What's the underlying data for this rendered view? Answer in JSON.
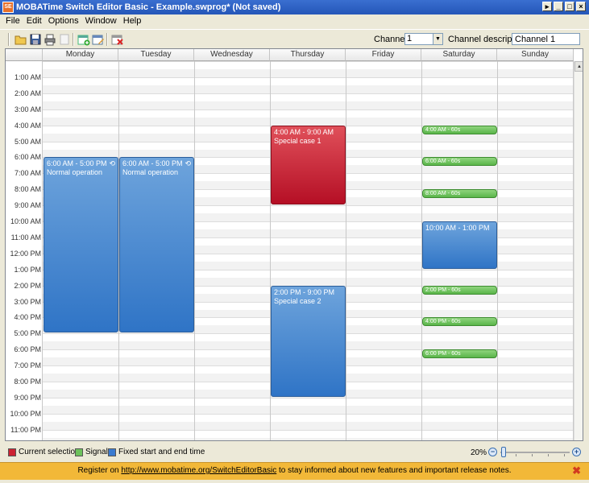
{
  "window": {
    "title": "MOBATime Switch Editor Basic - Example.swprog* (Not saved)",
    "icon_text": "SE"
  },
  "menu": [
    "File",
    "Edit",
    "Options",
    "Window",
    "Help"
  ],
  "toolbar": {
    "icons": [
      "new-document-icon",
      "open-folder-icon",
      "save-icon",
      "print-icon",
      "blank-icon",
      "add-event-icon",
      "edit-event-icon",
      "delete-event-icon"
    ],
    "channel_label": "Channel:",
    "channel_value": "1",
    "description_label": "Channel description:",
    "description_value": "Channel 1"
  },
  "calendar": {
    "days": [
      "Monday",
      "Tuesday",
      "Wednesday",
      "Thursday",
      "Friday",
      "Saturday",
      "Sunday"
    ],
    "hours": [
      "1:00 AM",
      "2:00 AM",
      "3:00 AM",
      "4:00 AM",
      "5:00 AM",
      "6:00 AM",
      "7:00 AM",
      "8:00 AM",
      "9:00 AM",
      "10:00 AM",
      "11:00 AM",
      "12:00 PM",
      "1:00 PM",
      "2:00 PM",
      "3:00 PM",
      "4:00 PM",
      "5:00 PM",
      "6:00 PM",
      "7:00 PM",
      "8:00 PM",
      "9:00 PM",
      "10:00 PM",
      "11:00 PM"
    ],
    "events": [
      {
        "day": 0,
        "start": 6,
        "end": 17,
        "time": "6:00 AM - 5:00 PM",
        "label": "Normal operation",
        "kind": "fixed",
        "recurring": true
      },
      {
        "day": 1,
        "start": 6,
        "end": 17,
        "time": "6:00 AM - 5:00 PM",
        "label": "Normal operation",
        "kind": "fixed",
        "recurring": true
      },
      {
        "day": 3,
        "start": 4,
        "end": 9,
        "time": "4:00 AM - 9:00 AM",
        "label": "Special case 1",
        "kind": "selection",
        "recurring": false
      },
      {
        "day": 3,
        "start": 14,
        "end": 21,
        "time": "2:00 PM - 9:00 PM",
        "label": "Special case 2",
        "kind": "fixed",
        "recurring": false
      },
      {
        "day": 5,
        "start": 10,
        "end": 13,
        "time": "10:00 AM - 1:00 PM",
        "label": "",
        "kind": "fixed",
        "recurring": false
      }
    ],
    "signals": [
      {
        "day": 5,
        "hour": 4,
        "label": "4:00 AM - 60s"
      },
      {
        "day": 5,
        "hour": 6,
        "label": "6:00 AM - 60s"
      },
      {
        "day": 5,
        "hour": 8,
        "label": "8:00 AM - 60s"
      },
      {
        "day": 5,
        "hour": 14,
        "label": "2:00 PM - 60s"
      },
      {
        "day": 5,
        "hour": 16,
        "label": "4:00 PM - 60s"
      },
      {
        "day": 5,
        "hour": 18,
        "label": "6:00 PM - 60s"
      }
    ]
  },
  "legend": {
    "items": [
      {
        "label": "Current selection",
        "color": "#cc2233"
      },
      {
        "label": "Signal",
        "color": "#6cc15b"
      },
      {
        "label": "Fixed start and end time",
        "color": "#3a7bd0"
      }
    ],
    "zoom": "20%"
  },
  "infobar": {
    "prefix": "Register on",
    "link": "http://www.mobatime.org/SwitchEditorBasic",
    "suffix": "to stay informed about new features and important release notes."
  }
}
